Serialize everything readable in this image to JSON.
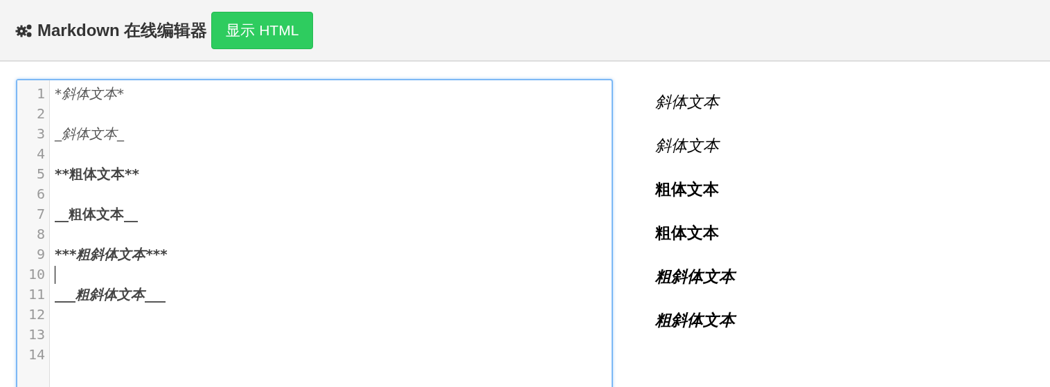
{
  "header": {
    "title": "Markdown 在线编辑器",
    "button": "显示 HTML"
  },
  "editor": {
    "lines": [
      {
        "number": "1",
        "cursor": false,
        "segments": [
          {
            "text": "*斜体文本*",
            "kind": "italic"
          }
        ]
      },
      {
        "number": "2",
        "cursor": false
      },
      {
        "number": "3",
        "cursor": false,
        "segments": [
          {
            "text": "_斜体文本_",
            "kind": "italic"
          }
        ]
      },
      {
        "number": "4",
        "cursor": false
      },
      {
        "number": "5",
        "cursor": false,
        "segments": [
          {
            "text": "**粗体文本**",
            "kind": "bold"
          }
        ]
      },
      {
        "number": "6",
        "cursor": false
      },
      {
        "number": "7",
        "cursor": false,
        "segments": [
          {
            "text": "__粗体文本__",
            "kind": "bold"
          }
        ]
      },
      {
        "number": "8",
        "cursor": false
      },
      {
        "number": "9",
        "cursor": false,
        "segments": [
          {
            "text": "***",
            "kind": "bold"
          },
          {
            "text": "粗斜体文本",
            "kind": "bolditalic"
          },
          {
            "text": "***",
            "kind": "bold"
          }
        ]
      },
      {
        "number": "10",
        "cursor": true
      },
      {
        "number": "11",
        "cursor": false,
        "segments": [
          {
            "text": "___",
            "kind": "bold"
          },
          {
            "text": "粗斜体文本",
            "kind": "bolditalic"
          },
          {
            "text": "___",
            "kind": "bold"
          }
        ]
      },
      {
        "number": "12",
        "cursor": false
      },
      {
        "number": "13",
        "cursor": false
      },
      {
        "number": "14",
        "cursor": false
      }
    ]
  },
  "preview": [
    {
      "text": "斜体文本",
      "kind": "italic"
    },
    {
      "text": "斜体文本",
      "kind": "italic"
    },
    {
      "text": "粗体文本",
      "kind": "bold"
    },
    {
      "text": "粗体文本",
      "kind": "bold"
    },
    {
      "text": "粗斜体文本",
      "kind": "bolditalic"
    },
    {
      "text": "粗斜体文本",
      "kind": "bolditalic"
    }
  ]
}
